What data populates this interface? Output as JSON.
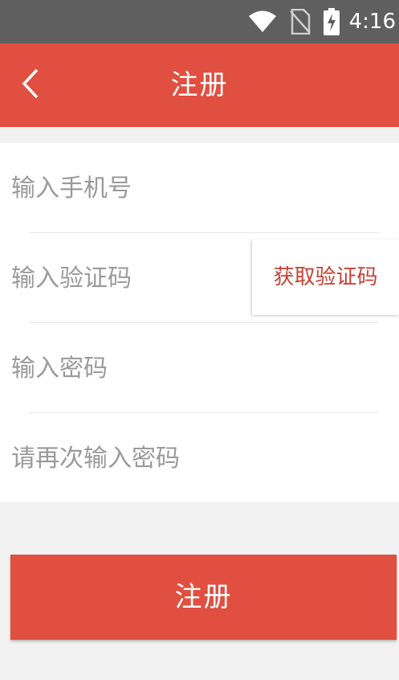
{
  "status_bar": {
    "time": "4:16",
    "icons": [
      "wifi-icon",
      "no-sim-icon",
      "battery-charging-icon"
    ]
  },
  "header": {
    "title": "注册",
    "back_icon": "chevron-left-icon"
  },
  "form": {
    "phone_placeholder": "输入手机号",
    "code_placeholder": "输入验证码",
    "get_code_label": "获取验证码",
    "password_placeholder": "输入密码",
    "confirm_password_placeholder": "请再次输入密码"
  },
  "submit": {
    "label": "注册"
  },
  "colors": {
    "accent": "#e04f40",
    "status_bar": "#5f5f5f",
    "background": "#f2f2f2",
    "code_text": "#c64232"
  }
}
